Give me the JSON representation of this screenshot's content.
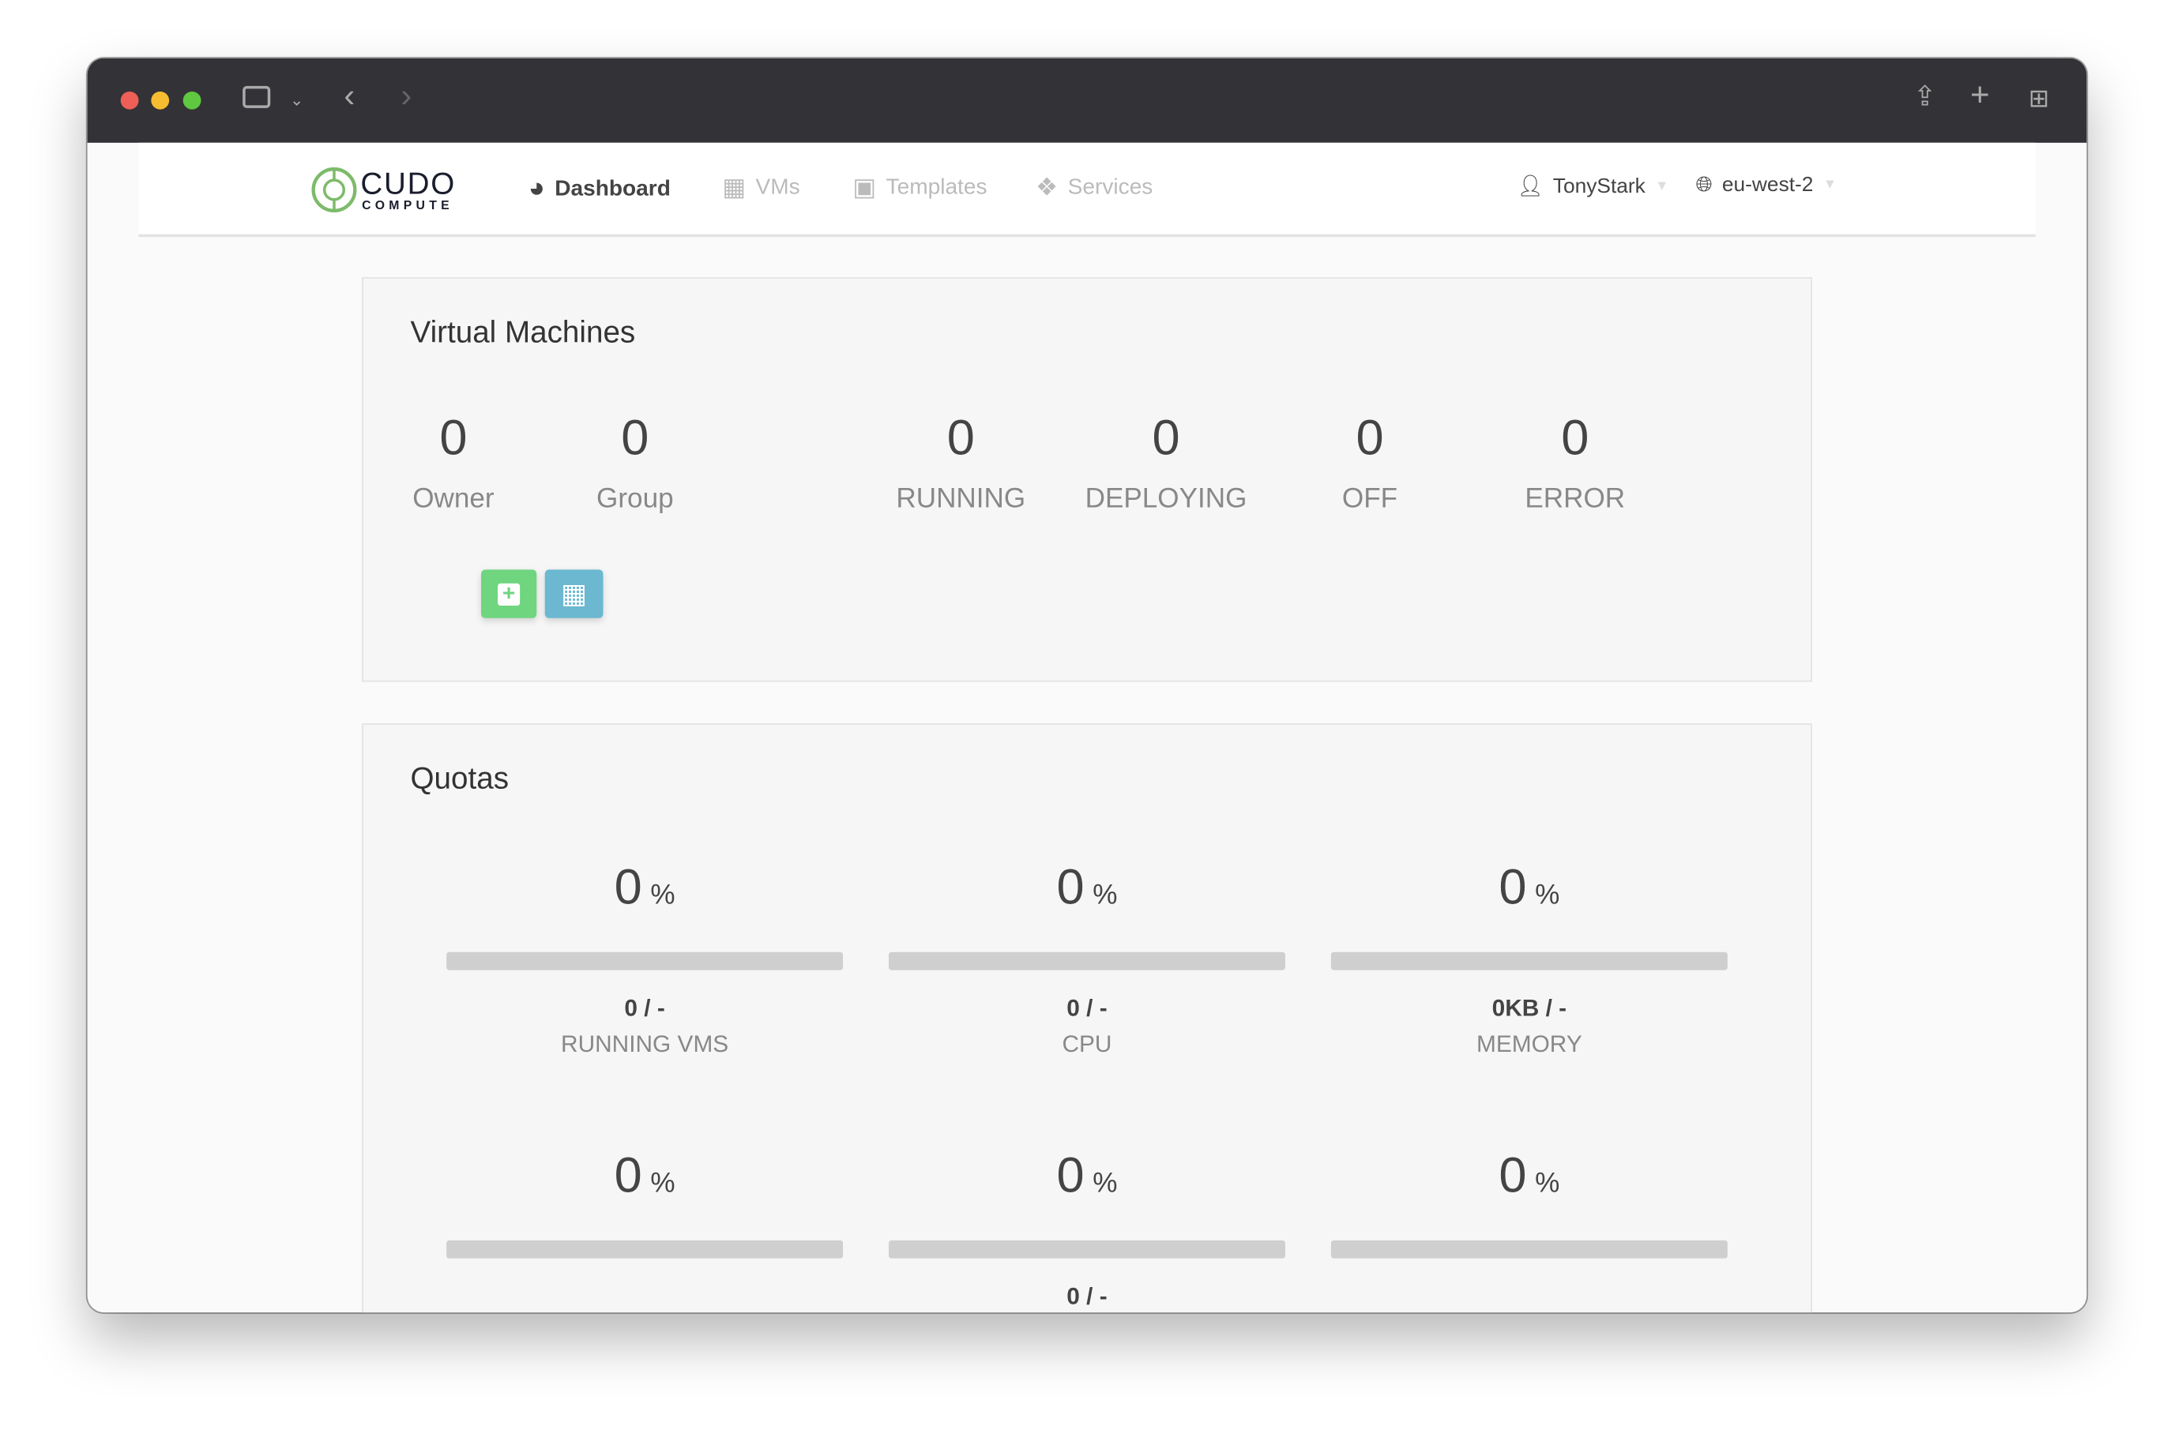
{
  "browser": {
    "colors": {
      "close": "#ee5f57",
      "min": "#f5bd2f",
      "max": "#5fc840"
    }
  },
  "header": {
    "logo_top": "CUDO",
    "logo_bottom": "COMPUTE",
    "nav": [
      {
        "label": "Dashboard",
        "icon": "dashboard-icon",
        "active": true
      },
      {
        "label": "VMs",
        "icon": "grid-icon"
      },
      {
        "label": "Templates",
        "icon": "save-icon"
      },
      {
        "label": "Services",
        "icon": "cubes-icon"
      }
    ],
    "user": "TonyStark",
    "region": "eu-west-2"
  },
  "vms": {
    "title": "Virtual Machines",
    "stats": [
      {
        "value": "0",
        "label": "Owner"
      },
      {
        "value": "0",
        "label": "Group"
      },
      {
        "value": "0",
        "label": "RUNNING"
      },
      {
        "value": "0",
        "label": "DEPLOYING"
      },
      {
        "value": "0",
        "label": "OFF"
      },
      {
        "value": "0",
        "label": "ERROR"
      }
    ],
    "colors": {
      "add": "#6fd57f",
      "list": "#6bb8d0"
    }
  },
  "quotas": {
    "title": "Quotas",
    "items": [
      {
        "percent": "0",
        "unit": "%",
        "used": "0 / -",
        "label": "RUNNING VMS"
      },
      {
        "percent": "0",
        "unit": "%",
        "used": "0 / -",
        "label": "CPU"
      },
      {
        "percent": "0",
        "unit": "%",
        "used": "0KB / -",
        "label": "MEMORY"
      },
      {
        "percent": "0",
        "unit": "%",
        "used": "",
        "label": ""
      },
      {
        "percent": "0",
        "unit": "%",
        "used": "0 / -",
        "label": ""
      },
      {
        "percent": "0",
        "unit": "%",
        "used": "",
        "label": ""
      }
    ]
  }
}
